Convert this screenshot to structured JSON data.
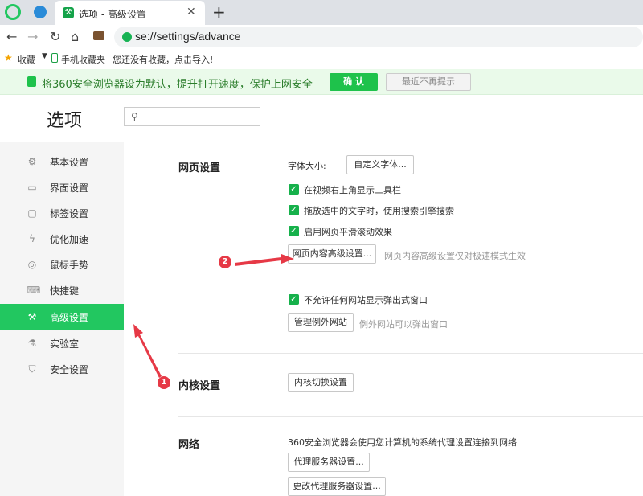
{
  "tabs": {
    "active_title": "选项 - 高级设置",
    "new_tab": "+"
  },
  "address": {
    "url": "se://settings/advance"
  },
  "bookmarks": {
    "favorites": "收藏",
    "mobile": "手机收藏夹",
    "empty_hint": "您还没有收藏，点击导入!"
  },
  "notice": {
    "text": "将360安全浏览器设为默认，提升打开速度，保护上网安全",
    "confirm": "确 认",
    "dismiss": "最近不再提示"
  },
  "header": {
    "title": "选项"
  },
  "sidebar": {
    "items": [
      {
        "label": "基本设置",
        "icon": "gear-icon"
      },
      {
        "label": "界面设置",
        "icon": "window-icon"
      },
      {
        "label": "标签设置",
        "icon": "tab-icon"
      },
      {
        "label": "优化加速",
        "icon": "lightning-icon"
      },
      {
        "label": "鼠标手势",
        "icon": "mouse-icon"
      },
      {
        "label": "快捷键",
        "icon": "keyboard-icon"
      },
      {
        "label": "高级设置",
        "icon": "wrench-icon",
        "active": true
      },
      {
        "label": "实验室",
        "icon": "flask-icon"
      },
      {
        "label": "安全设置",
        "icon": "shield-icon"
      }
    ]
  },
  "web_settings": {
    "title": "网页设置",
    "font_size_label": "字体大小:",
    "custom_font_button": "自定义字体...",
    "checkboxes": [
      "在视频右上角显示工具栏",
      "拖放选中的文字时，使用搜索引擎搜索",
      "启用网页平滑滚动效果"
    ],
    "advanced_button": "网页内容高级设置...",
    "advanced_note": "网页内容高级设置仅对极速模式生效",
    "popup_checkbox": "不允许任何网站显示弹出式窗口",
    "exception_button": "管理例外网站",
    "exception_note": "例外网站可以弹出窗口"
  },
  "kernel": {
    "title": "内核设置",
    "button": "内核切换设置"
  },
  "network": {
    "title": "网络",
    "desc": "360安全浏览器会使用您计算机的系统代理设置连接到网络",
    "proxy_button": "代理服务器设置...",
    "change_proxy_button": "更改代理服务器设置..."
  },
  "annotations": {
    "badge1": "1",
    "badge2": "2"
  },
  "colors": {
    "accent": "#22c760",
    "badge": "#e63946"
  }
}
